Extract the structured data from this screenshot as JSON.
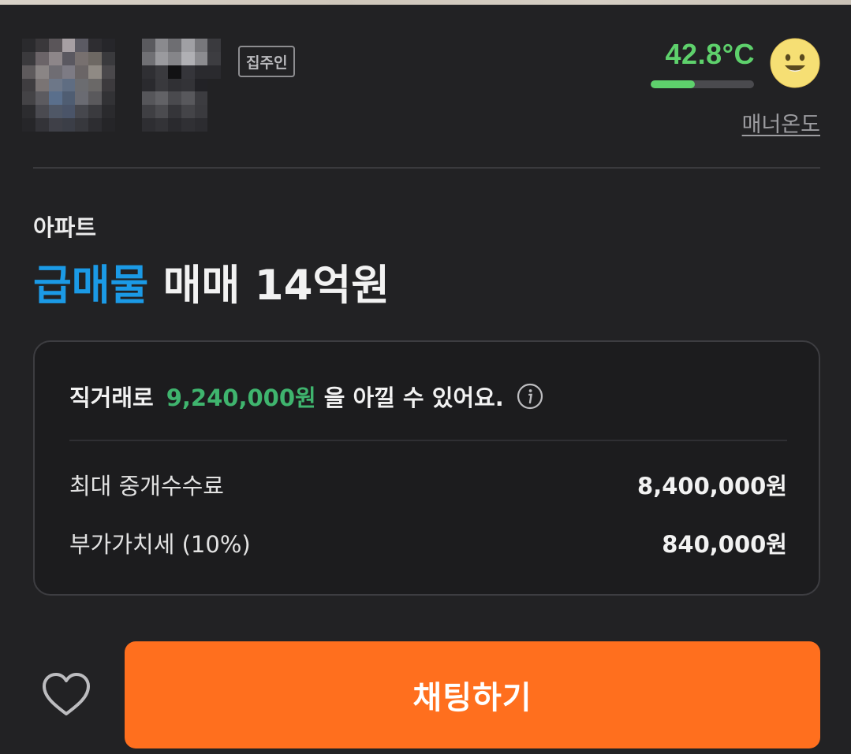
{
  "profile": {
    "badge": "집주인"
  },
  "manner": {
    "temperature": "42.8°C",
    "temperature_level": 0.43,
    "label": "매너온도",
    "face_icon": "smiley-face-icon",
    "accent_color": "#5ed16c"
  },
  "listing": {
    "property_type": "아파트",
    "urgent_label": "급매물",
    "deal_price": "매매 14억원",
    "urgent_color": "#1b9ae6"
  },
  "savings": {
    "prefix": "직거래로",
    "amount": "9,240,000원",
    "suffix": "을 아낄 수 있어요.",
    "info_icon": "info-icon",
    "amount_color": "#3fb46e",
    "fees": [
      {
        "label": "최대 중개수수료",
        "value": "8,400,000원"
      },
      {
        "label": "부가가치세 (10%)",
        "value": "840,000원"
      }
    ]
  },
  "actions": {
    "like_icon": "heart-icon",
    "chat_label": "채팅하기",
    "chat_color": "#ff6f1e"
  }
}
